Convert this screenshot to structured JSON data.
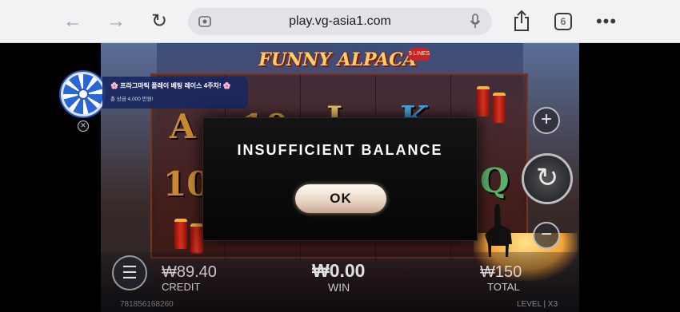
{
  "browser": {
    "url": "play.vg-asia1.com",
    "tab_count": "6",
    "back_icon": "←",
    "forward_icon": "→",
    "reload_icon": "↻",
    "more_icon": "•••"
  },
  "game": {
    "logo": "FUNNY ALPACA",
    "logo_badge": "5 LINES",
    "reels": [
      {
        "symbols": [
          "A",
          "10"
        ]
      },
      {
        "symbols": [
          "10"
        ]
      },
      {
        "symbols": [
          "J"
        ]
      },
      {
        "symbols": [
          "K"
        ]
      },
      {
        "symbols": [
          "Q"
        ]
      }
    ],
    "credit": {
      "value": "₩89.40",
      "label": "CREDIT"
    },
    "win": {
      "value": "₩0.00",
      "label": "WIN"
    },
    "total": {
      "value": "₩150",
      "label": "TOTAL"
    },
    "game_id": "781856168260",
    "level": "LEVEL | X3",
    "controls": {
      "plus": "+",
      "minus": "−",
      "spin": "↻",
      "menu": "☰"
    }
  },
  "promo": {
    "title": "🌸 프라그마틱 플레이 베팅 레이스 4주차! 🌸",
    "subtitle": "총 상금 4,000 만원!",
    "close": "✕"
  },
  "modal": {
    "title": "INSUFFICIENT BALANCE",
    "ok_label": "OK"
  }
}
